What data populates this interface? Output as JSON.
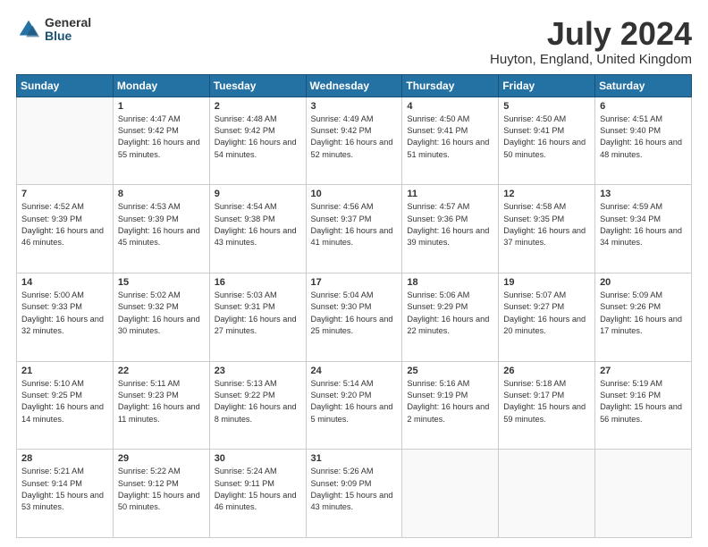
{
  "logo": {
    "general": "General",
    "blue": "Blue"
  },
  "title": "July 2024",
  "subtitle": "Huyton, England, United Kingdom",
  "headers": [
    "Sunday",
    "Monday",
    "Tuesday",
    "Wednesday",
    "Thursday",
    "Friday",
    "Saturday"
  ],
  "weeks": [
    [
      {
        "day": "",
        "sunrise": "",
        "sunset": "",
        "daylight": ""
      },
      {
        "day": "1",
        "sunrise": "4:47 AM",
        "sunset": "9:42 PM",
        "daylight": "16 hours and 55 minutes."
      },
      {
        "day": "2",
        "sunrise": "4:48 AM",
        "sunset": "9:42 PM",
        "daylight": "16 hours and 54 minutes."
      },
      {
        "day": "3",
        "sunrise": "4:49 AM",
        "sunset": "9:42 PM",
        "daylight": "16 hours and 52 minutes."
      },
      {
        "day": "4",
        "sunrise": "4:50 AM",
        "sunset": "9:41 PM",
        "daylight": "16 hours and 51 minutes."
      },
      {
        "day": "5",
        "sunrise": "4:50 AM",
        "sunset": "9:41 PM",
        "daylight": "16 hours and 50 minutes."
      },
      {
        "day": "6",
        "sunrise": "4:51 AM",
        "sunset": "9:40 PM",
        "daylight": "16 hours and 48 minutes."
      }
    ],
    [
      {
        "day": "7",
        "sunrise": "4:52 AM",
        "sunset": "9:39 PM",
        "daylight": "16 hours and 46 minutes."
      },
      {
        "day": "8",
        "sunrise": "4:53 AM",
        "sunset": "9:39 PM",
        "daylight": "16 hours and 45 minutes."
      },
      {
        "day": "9",
        "sunrise": "4:54 AM",
        "sunset": "9:38 PM",
        "daylight": "16 hours and 43 minutes."
      },
      {
        "day": "10",
        "sunrise": "4:56 AM",
        "sunset": "9:37 PM",
        "daylight": "16 hours and 41 minutes."
      },
      {
        "day": "11",
        "sunrise": "4:57 AM",
        "sunset": "9:36 PM",
        "daylight": "16 hours and 39 minutes."
      },
      {
        "day": "12",
        "sunrise": "4:58 AM",
        "sunset": "9:35 PM",
        "daylight": "16 hours and 37 minutes."
      },
      {
        "day": "13",
        "sunrise": "4:59 AM",
        "sunset": "9:34 PM",
        "daylight": "16 hours and 34 minutes."
      }
    ],
    [
      {
        "day": "14",
        "sunrise": "5:00 AM",
        "sunset": "9:33 PM",
        "daylight": "16 hours and 32 minutes."
      },
      {
        "day": "15",
        "sunrise": "5:02 AM",
        "sunset": "9:32 PM",
        "daylight": "16 hours and 30 minutes."
      },
      {
        "day": "16",
        "sunrise": "5:03 AM",
        "sunset": "9:31 PM",
        "daylight": "16 hours and 27 minutes."
      },
      {
        "day": "17",
        "sunrise": "5:04 AM",
        "sunset": "9:30 PM",
        "daylight": "16 hours and 25 minutes."
      },
      {
        "day": "18",
        "sunrise": "5:06 AM",
        "sunset": "9:29 PM",
        "daylight": "16 hours and 22 minutes."
      },
      {
        "day": "19",
        "sunrise": "5:07 AM",
        "sunset": "9:27 PM",
        "daylight": "16 hours and 20 minutes."
      },
      {
        "day": "20",
        "sunrise": "5:09 AM",
        "sunset": "9:26 PM",
        "daylight": "16 hours and 17 minutes."
      }
    ],
    [
      {
        "day": "21",
        "sunrise": "5:10 AM",
        "sunset": "9:25 PM",
        "daylight": "16 hours and 14 minutes."
      },
      {
        "day": "22",
        "sunrise": "5:11 AM",
        "sunset": "9:23 PM",
        "daylight": "16 hours and 11 minutes."
      },
      {
        "day": "23",
        "sunrise": "5:13 AM",
        "sunset": "9:22 PM",
        "daylight": "16 hours and 8 minutes."
      },
      {
        "day": "24",
        "sunrise": "5:14 AM",
        "sunset": "9:20 PM",
        "daylight": "16 hours and 5 minutes."
      },
      {
        "day": "25",
        "sunrise": "5:16 AM",
        "sunset": "9:19 PM",
        "daylight": "16 hours and 2 minutes."
      },
      {
        "day": "26",
        "sunrise": "5:18 AM",
        "sunset": "9:17 PM",
        "daylight": "15 hours and 59 minutes."
      },
      {
        "day": "27",
        "sunrise": "5:19 AM",
        "sunset": "9:16 PM",
        "daylight": "15 hours and 56 minutes."
      }
    ],
    [
      {
        "day": "28",
        "sunrise": "5:21 AM",
        "sunset": "9:14 PM",
        "daylight": "15 hours and 53 minutes."
      },
      {
        "day": "29",
        "sunrise": "5:22 AM",
        "sunset": "9:12 PM",
        "daylight": "15 hours and 50 minutes."
      },
      {
        "day": "30",
        "sunrise": "5:24 AM",
        "sunset": "9:11 PM",
        "daylight": "15 hours and 46 minutes."
      },
      {
        "day": "31",
        "sunrise": "5:26 AM",
        "sunset": "9:09 PM",
        "daylight": "15 hours and 43 minutes."
      },
      {
        "day": "",
        "sunrise": "",
        "sunset": "",
        "daylight": ""
      },
      {
        "day": "",
        "sunrise": "",
        "sunset": "",
        "daylight": ""
      },
      {
        "day": "",
        "sunrise": "",
        "sunset": "",
        "daylight": ""
      }
    ]
  ]
}
